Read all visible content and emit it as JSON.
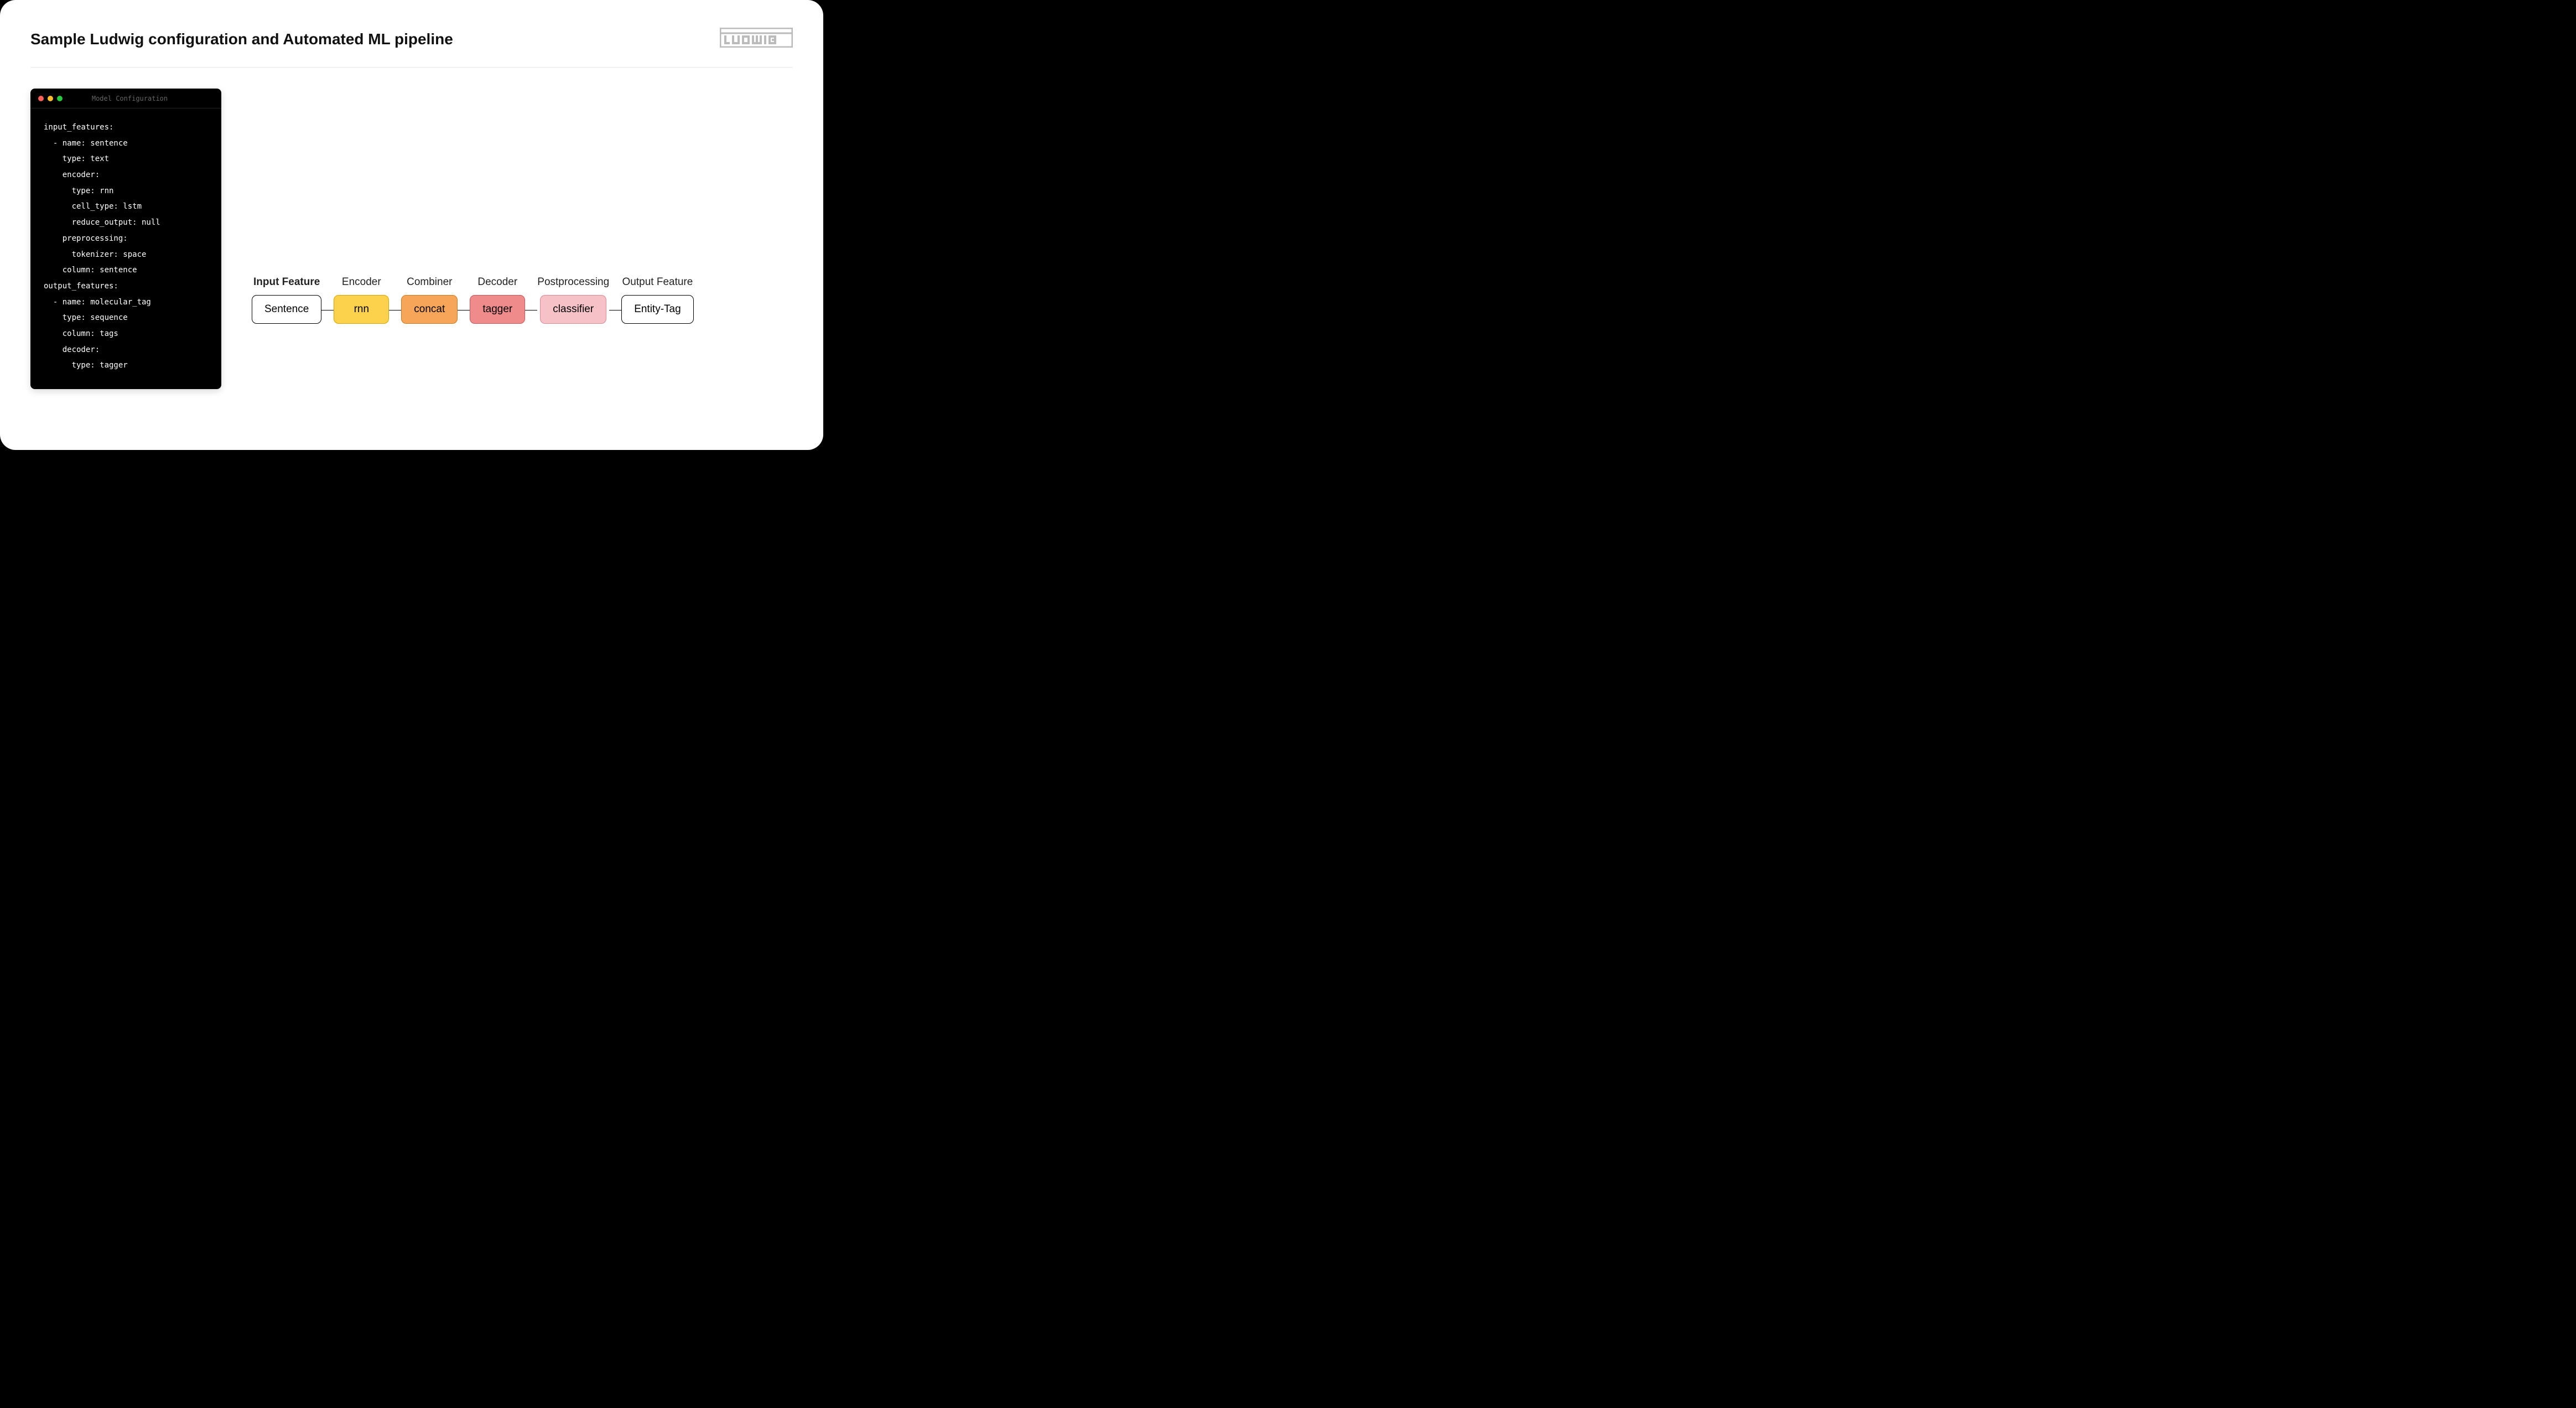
{
  "title": "Sample Ludwig configuration and Automated ML pipeline",
  "logo_text": "LUDWIG",
  "terminal": {
    "title": "Model Configuration",
    "code": "input_features:\n  - name: sentence\n    type: text\n    encoder:\n      type: rnn\n      cell_type: lstm\n      reduce_output: null\n    preprocessing:\n      tokenizer: space\n    column: sentence\noutput_features:\n  - name: molecular_tag\n    type: sequence\n    column: tags\n    decoder:\n      type: tagger"
  },
  "pipeline": {
    "stages": [
      {
        "label": "Input Feature",
        "value": "Sentence",
        "color": "white",
        "bold": true
      },
      {
        "label": "Encoder",
        "value": "rnn",
        "color": "yellow",
        "bold": false
      },
      {
        "label": "Combiner",
        "value": "concat",
        "color": "orange",
        "bold": false
      },
      {
        "label": "Decoder",
        "value": "tagger",
        "color": "coral",
        "bold": false
      },
      {
        "label": "Postprocessing",
        "value": "classifier",
        "color": "pink",
        "bold": false
      },
      {
        "label": "Output Feature",
        "value": "Entity-Tag",
        "color": "white",
        "bold": false
      }
    ]
  }
}
